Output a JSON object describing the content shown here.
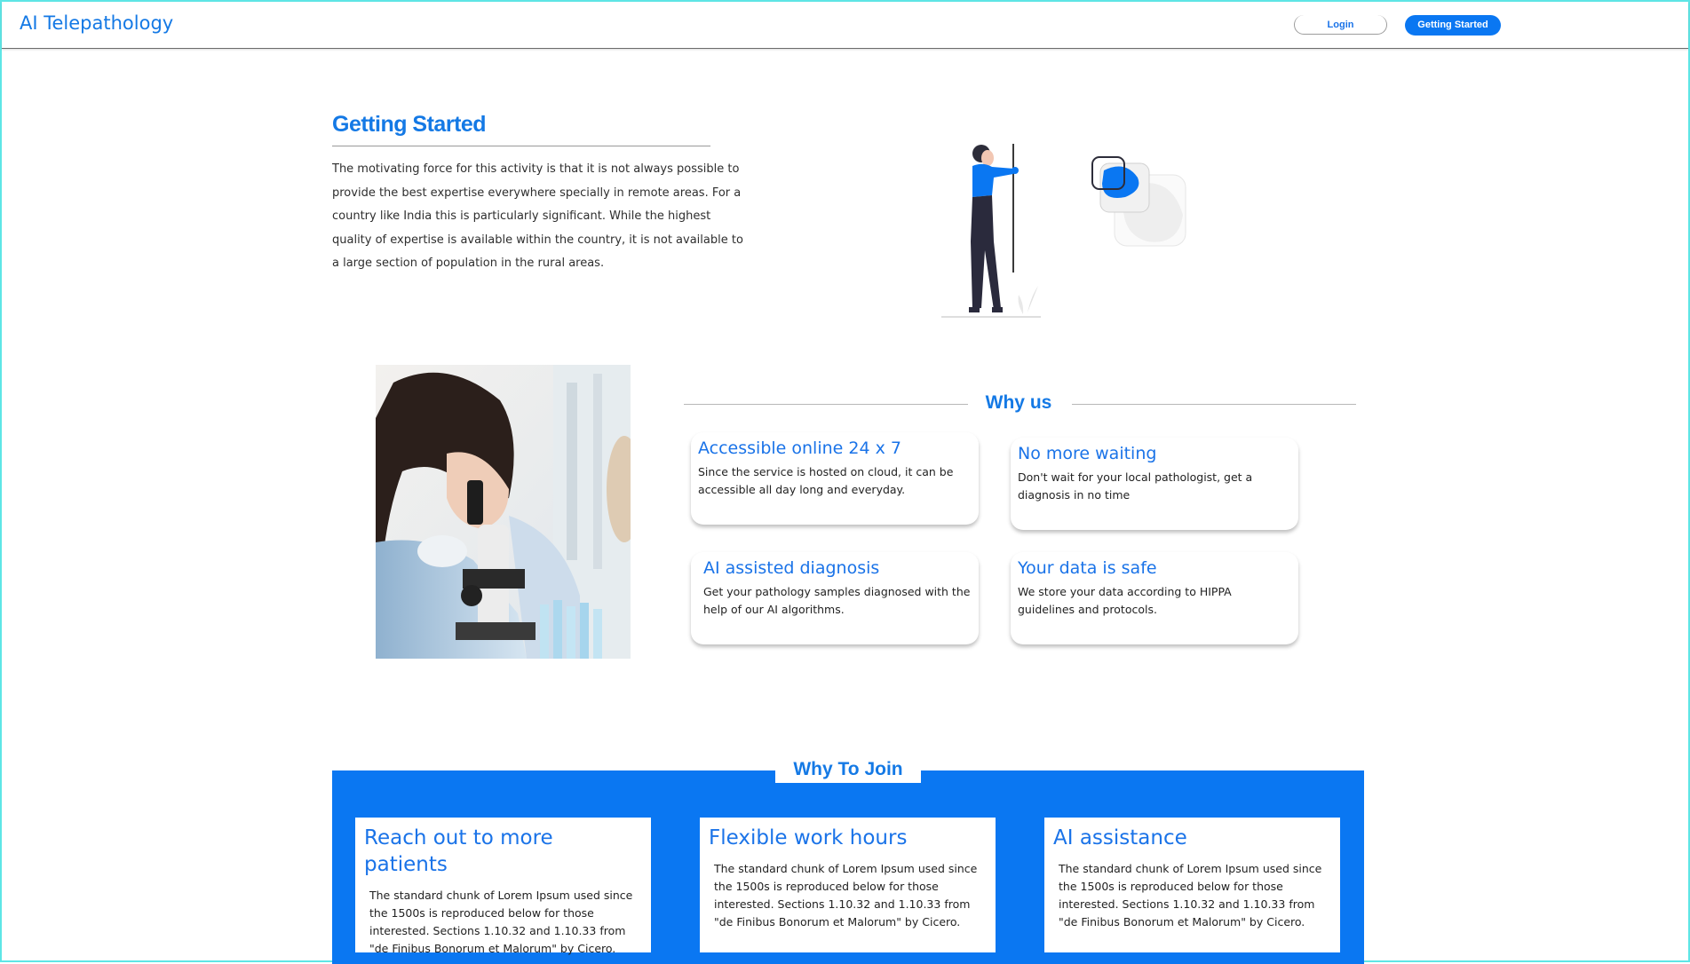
{
  "header": {
    "brand": "AI Telepathology",
    "login_label": "Login",
    "getting_started_label": "Getting Started"
  },
  "getting_started": {
    "title": "Getting Started",
    "text": "The motivating force for this activity is that it is not always possible to provide the best expertise everywhere specially in remote areas. For a country like India this is particularly significant. While the highest quality of expertise is available within the country, it is not available to a large section of population in the rural areas."
  },
  "why_us": {
    "title": "Why us",
    "features": [
      {
        "title": "Accessible online 24 x 7",
        "desc": "Since the service is hosted on cloud, it can be accessible all day long and everyday."
      },
      {
        "title": "No more waiting",
        "desc": "Don't wait for your local pathologist, get a diagnosis in no time"
      },
      {
        "title": "AI assisted diagnosis",
        "desc": "Get your pathology samples diagnosed with the help of our AI algorithms."
      },
      {
        "title": "Your data is safe",
        "desc": "We store your data according to HIPPA guidelines and protocols."
      }
    ]
  },
  "why_join": {
    "title": "Why To Join",
    "cards": [
      {
        "title": "Reach out to more patients",
        "desc": "The standard chunk of Lorem Ipsum used since the 1500s is reproduced below for those interested. Sections 1.10.32 and 1.10.33 from \"de Finibus Bonorum et Malorum\" by Cicero."
      },
      {
        "title": "Flexible work hours",
        "desc": "The standard chunk of Lorem Ipsum used since the 1500s is reproduced below for those interested. Sections 1.10.32 and 1.10.33 from \"de Finibus Bonorum et Malorum\" by Cicero."
      },
      {
        "title": "AI assistance",
        "desc": "The standard chunk of Lorem Ipsum used since the 1500s is reproduced below for those interested. Sections 1.10.32 and 1.10.33 from \"de Finibus Bonorum et Malorum\" by Cicero."
      }
    ]
  },
  "colors": {
    "accent": "#1479e5",
    "primary_button": "#0a77f2",
    "band": "#0a77f2"
  },
  "icons": {
    "illustration": "woman-with-pole-and-blobs-illustration",
    "photo": "scientist-with-microscope-photo"
  }
}
